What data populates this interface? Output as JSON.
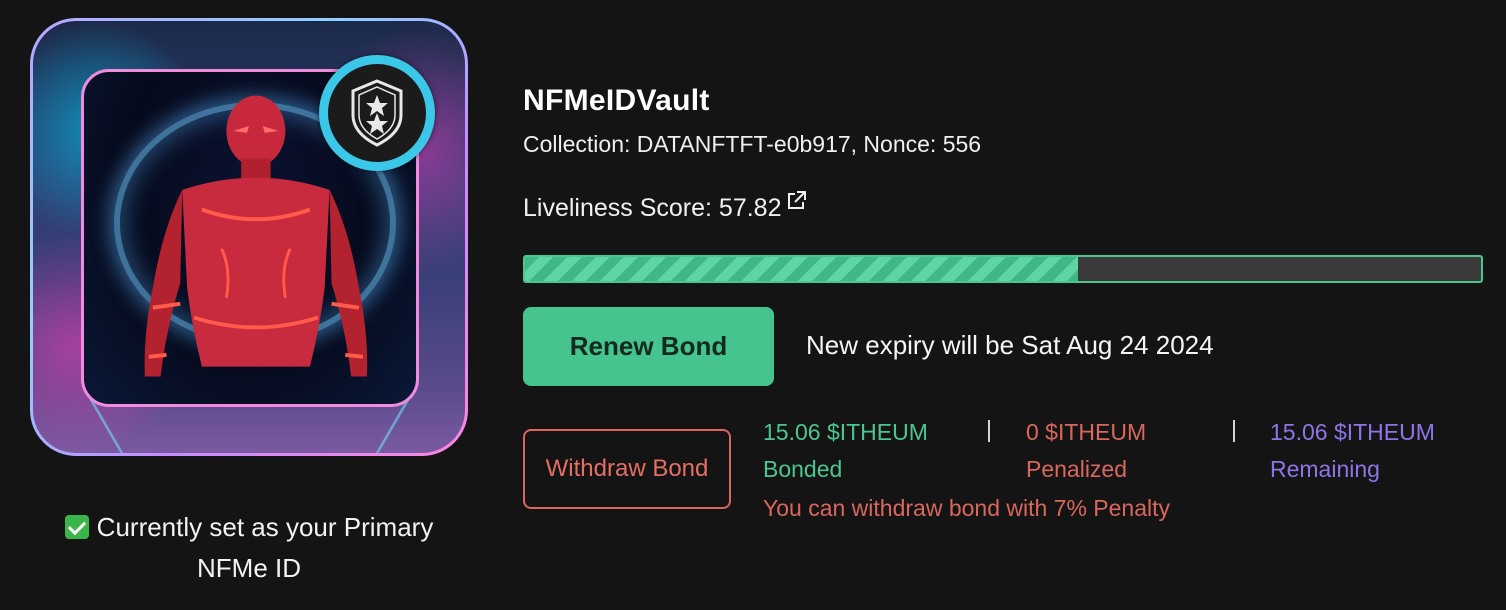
{
  "card": {
    "badge_icon": "stars-shield-icon"
  },
  "primary_note": {
    "icon": "check-icon",
    "text": "Currently set as your Primary NFMe ID"
  },
  "vault": {
    "title": "NFMeIDVault",
    "collection_text": "Collection: DATANFTFT-e0b917, Nonce: 556",
    "liveliness_label": "Liveliness Score: 57.82",
    "liveliness_score": 57.82,
    "progress_fraction": 0.5782
  },
  "actions": {
    "renew_label": "Renew Bond",
    "expiry_text": "New expiry will be Sat Aug 24 2024",
    "withdraw_label": "Withdraw Bond"
  },
  "stats": {
    "bonded": {
      "value": "15.06 $ITHEUM",
      "label": "Bonded"
    },
    "penalized": {
      "value": "0 $ITHEUM",
      "label": "Penalized"
    },
    "remaining": {
      "value": "15.06 $ITHEUM",
      "label": "Remaining"
    },
    "separator": "|"
  },
  "penalty_note": "You can withdraw bond with 7% Penalty",
  "colors": {
    "accent_green": "#45c48e",
    "penalty_red": "#d9675d",
    "remaining_purple": "#8f74e8",
    "background": "#141414"
  }
}
